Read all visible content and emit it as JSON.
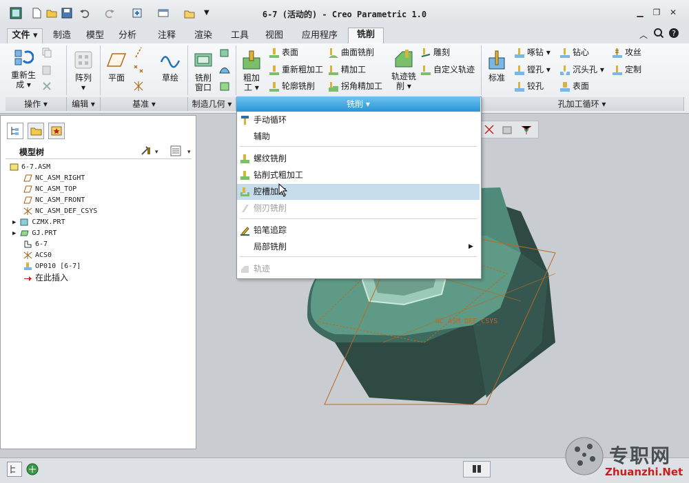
{
  "window": {
    "title": "6-7 (活动的) - Creo Parametric 1.0"
  },
  "tabs": [
    {
      "label": "文件"
    },
    {
      "label": "制造"
    },
    {
      "label": "模型"
    },
    {
      "label": "分析"
    },
    {
      "label": "注释"
    },
    {
      "label": "渲染"
    },
    {
      "label": "工具"
    },
    {
      "label": "视图"
    },
    {
      "label": "应用程序"
    },
    {
      "label": "铣削"
    }
  ],
  "ribbon": {
    "groups": {
      "operation": "操作",
      "edit": "编辑",
      "datum": "基准",
      "mfg_geom": "制造几何",
      "milling": "铣削",
      "hole_cycle": "孔加工循环"
    },
    "buttons": {
      "regen_1": "重新生",
      "regen_2": "成",
      "array": "阵列",
      "plane": "平面",
      "sketch": "草绘",
      "mill_window_1": "铣削",
      "mill_window_2": "窗口",
      "rough_1": "粗加",
      "rough_2": "工",
      "trajectory_1": "轨迹铣",
      "trajectory_2": "削",
      "standard": "标准",
      "surface": "表面",
      "re_rough": "重新粗加工",
      "profile": "轮廓铣削",
      "surface_mill": "曲面铣削",
      "finish": "精加工",
      "corner_finish": "拐角精加工",
      "engrave": "雕刻",
      "custom_traj": "自定义轨迹",
      "peck": "啄钻",
      "bore": "镗孔",
      "ream": "铰孔",
      "center_drill": "钻心",
      "countersink": "沉头孔",
      "face": "表面",
      "tap": "攻丝",
      "custom": "定制"
    }
  },
  "panel": {
    "title": "模型树",
    "tree": [
      "6-7.ASM",
      "NC_ASM_RIGHT",
      "NC_ASM_TOP",
      "NC_ASM_FRONT",
      "NC_ASM_DEF_CSYS",
      "CZMX.PRT",
      "GJ.PRT",
      "6-7",
      "ACS0",
      "OP010 [6-7]",
      "在此插入"
    ]
  },
  "menu": {
    "header": "铣削",
    "items": [
      {
        "label": "手动循环"
      },
      {
        "label": "辅助"
      },
      {
        "label": "螺纹铣削"
      },
      {
        "label": "钻削式粗加工"
      },
      {
        "label": "腔槽加工"
      },
      {
        "label": "侧刃铣削"
      },
      {
        "label": "铅笔追踪"
      },
      {
        "label": "局部铣削"
      },
      {
        "label": "轨迹"
      }
    ]
  },
  "viewport": {
    "csys_label": "NC_ASM_DEF_CSYS"
  },
  "watermark": {
    "cn": "专职网",
    "url": "Zhuanzhi.Net"
  },
  "colors": {
    "accent": "#2a95d6",
    "part": "#3d6b5f",
    "highlight": "#c6dcea"
  }
}
